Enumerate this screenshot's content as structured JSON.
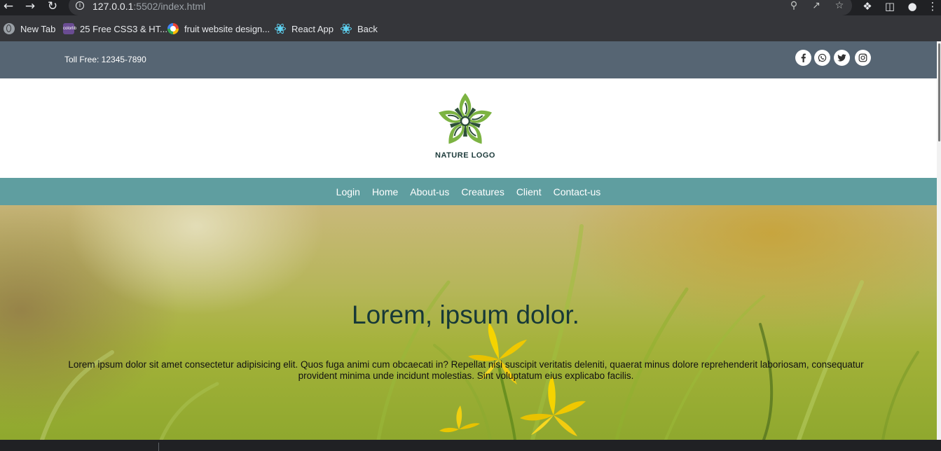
{
  "browser": {
    "url_host": "127.0.0.1",
    "url_path": ":5502/index.html",
    "bookmarks": [
      {
        "label": "New Tab",
        "icon": "globe-icon"
      },
      {
        "label": "25 Free CSS3 & HT...",
        "icon": "colorlib-icon",
        "icon_text": "colorlib"
      },
      {
        "label": "fruit website design...",
        "icon": "google-icon"
      },
      {
        "label": "React App",
        "icon": "react-icon"
      },
      {
        "label": "Back",
        "icon": "react-icon"
      }
    ]
  },
  "topbar": {
    "toll_free": "Toll Free: 12345-7890",
    "social": [
      "facebook-icon",
      "whatsapp-icon",
      "twitter-icon",
      "instagram-icon"
    ]
  },
  "logo": {
    "text": "NATURE LOGO"
  },
  "nav": {
    "items": [
      "Login",
      "Home",
      "About-us",
      "Creatures",
      "Client",
      "Contact-us"
    ]
  },
  "hero": {
    "title": "Lorem, ipsum dolor.",
    "text": "Lorem ipsum dolor sit amet consectetur adipisicing elit. Quos fuga animi cum obcaecati in? Repellat nisi suscipit veritatis deleniti, quaerat minus dolore reprehenderit laboriosam, consequatur provident minima unde incidunt molestias. Sint voluptatum eius explicabo facilis."
  },
  "colors": {
    "topbar": "#566573",
    "navbar": "#5f9ea0",
    "logo_green": "#7cb342",
    "title": "#163838"
  }
}
